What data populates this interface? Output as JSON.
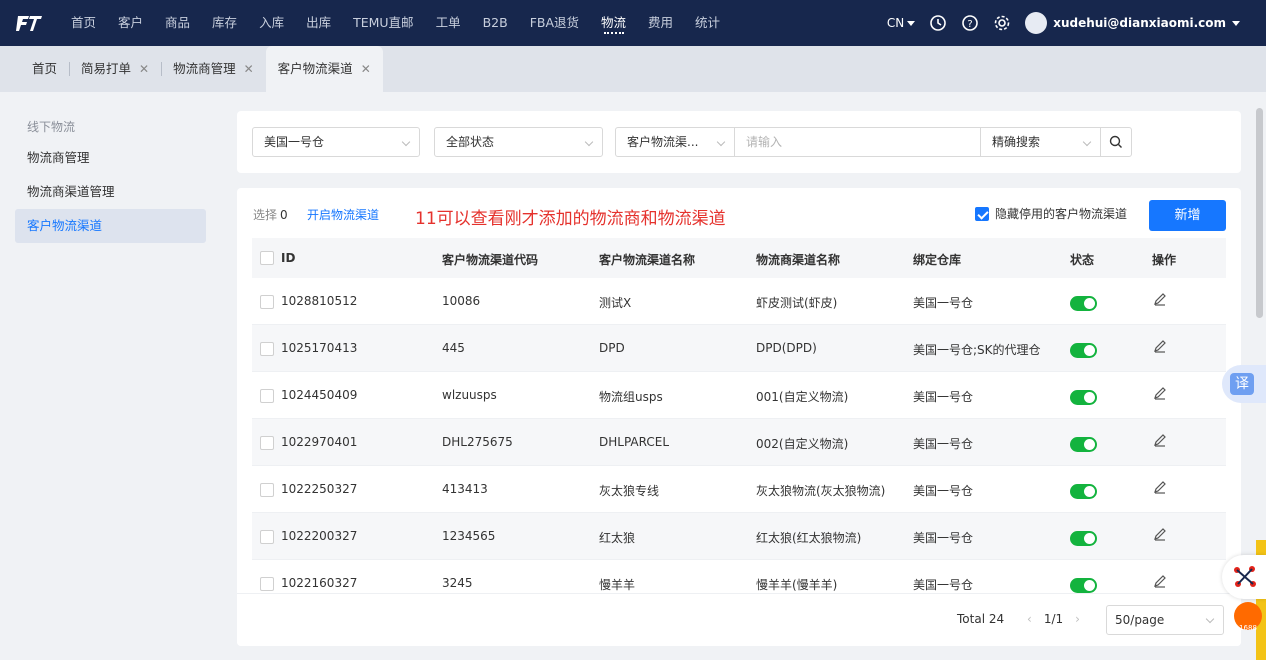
{
  "nav": {
    "items": [
      "首页",
      "客户",
      "商品",
      "库存",
      "入库",
      "出库",
      "TEMU直邮",
      "工单",
      "B2B",
      "FBA退货",
      "物流",
      "费用",
      "统计"
    ],
    "active": "物流",
    "lang": "CN",
    "user": "xudehui@dianxiaomi.com"
  },
  "tabs": [
    {
      "label": "首页",
      "closable": false
    },
    {
      "label": "简易打单",
      "closable": true
    },
    {
      "label": "物流商管理",
      "closable": true
    },
    {
      "label": "客户物流渠道",
      "closable": true,
      "active": true
    }
  ],
  "sidebar": {
    "group": "线下物流",
    "items": [
      "物流商管理",
      "物流商渠道管理",
      "客户物流渠道"
    ],
    "active": "客户物流渠道"
  },
  "filters": {
    "warehouse": "美国一号仓",
    "status": "全部状态",
    "field": "客户物流渠...",
    "search_placeholder": "请输入",
    "match": "精确搜索"
  },
  "toolbar": {
    "select_label": "选择",
    "select_count": "0",
    "enable_link": "开启物流渠道",
    "annotation": "11可以查看刚才添加的物流商和物流渠道",
    "hide_disabled": "隐藏停用的客户物流渠道",
    "add_button": "新增"
  },
  "table": {
    "headers": [
      "ID",
      "客户物流渠道代码",
      "客户物流渠道名称",
      "物流商渠道名称",
      "绑定仓库",
      "状态",
      "操作"
    ],
    "rows": [
      {
        "id": "1028810512",
        "code": "10086",
        "name": "测试X",
        "provider": "虾皮测试(虾皮)",
        "warehouse": "美国一号仓",
        "enabled": true
      },
      {
        "id": "1025170413",
        "code": "445",
        "name": "DPD",
        "provider": "DPD(DPD)",
        "warehouse": "美国一号仓;SK的代理仓",
        "enabled": true
      },
      {
        "id": "1024450409",
        "code": "wlzuusps",
        "name": "物流组usps",
        "provider": "001(自定义物流)",
        "warehouse": "美国一号仓",
        "enabled": true
      },
      {
        "id": "1022970401",
        "code": "DHL275675",
        "name": "DHLPARCEL",
        "provider": "002(自定义物流)",
        "warehouse": "美国一号仓",
        "enabled": true
      },
      {
        "id": "1022250327",
        "code": "413413",
        "name": "灰太狼专线",
        "provider": "灰太狼物流(灰太狼物流)",
        "warehouse": "美国一号仓",
        "enabled": true
      },
      {
        "id": "1022200327",
        "code": "1234565",
        "name": "红太狼",
        "provider": "红太狼(红太狼物流)",
        "warehouse": "美国一号仓",
        "enabled": true
      },
      {
        "id": "1022160327",
        "code": "3245",
        "name": "慢羊羊",
        "provider": "慢羊羊(慢羊羊)",
        "warehouse": "美国一号仓",
        "enabled": true
      }
    ]
  },
  "pagination": {
    "total": "Total 24",
    "page": "1/1",
    "page_size": "50/page"
  },
  "float": {
    "translate": "译",
    "ali_label": "1688"
  },
  "colors": {
    "nav_bg": "#17274d",
    "primary": "#1677ff",
    "toggle_on": "#13b33e",
    "annotation": "#e5322d"
  }
}
